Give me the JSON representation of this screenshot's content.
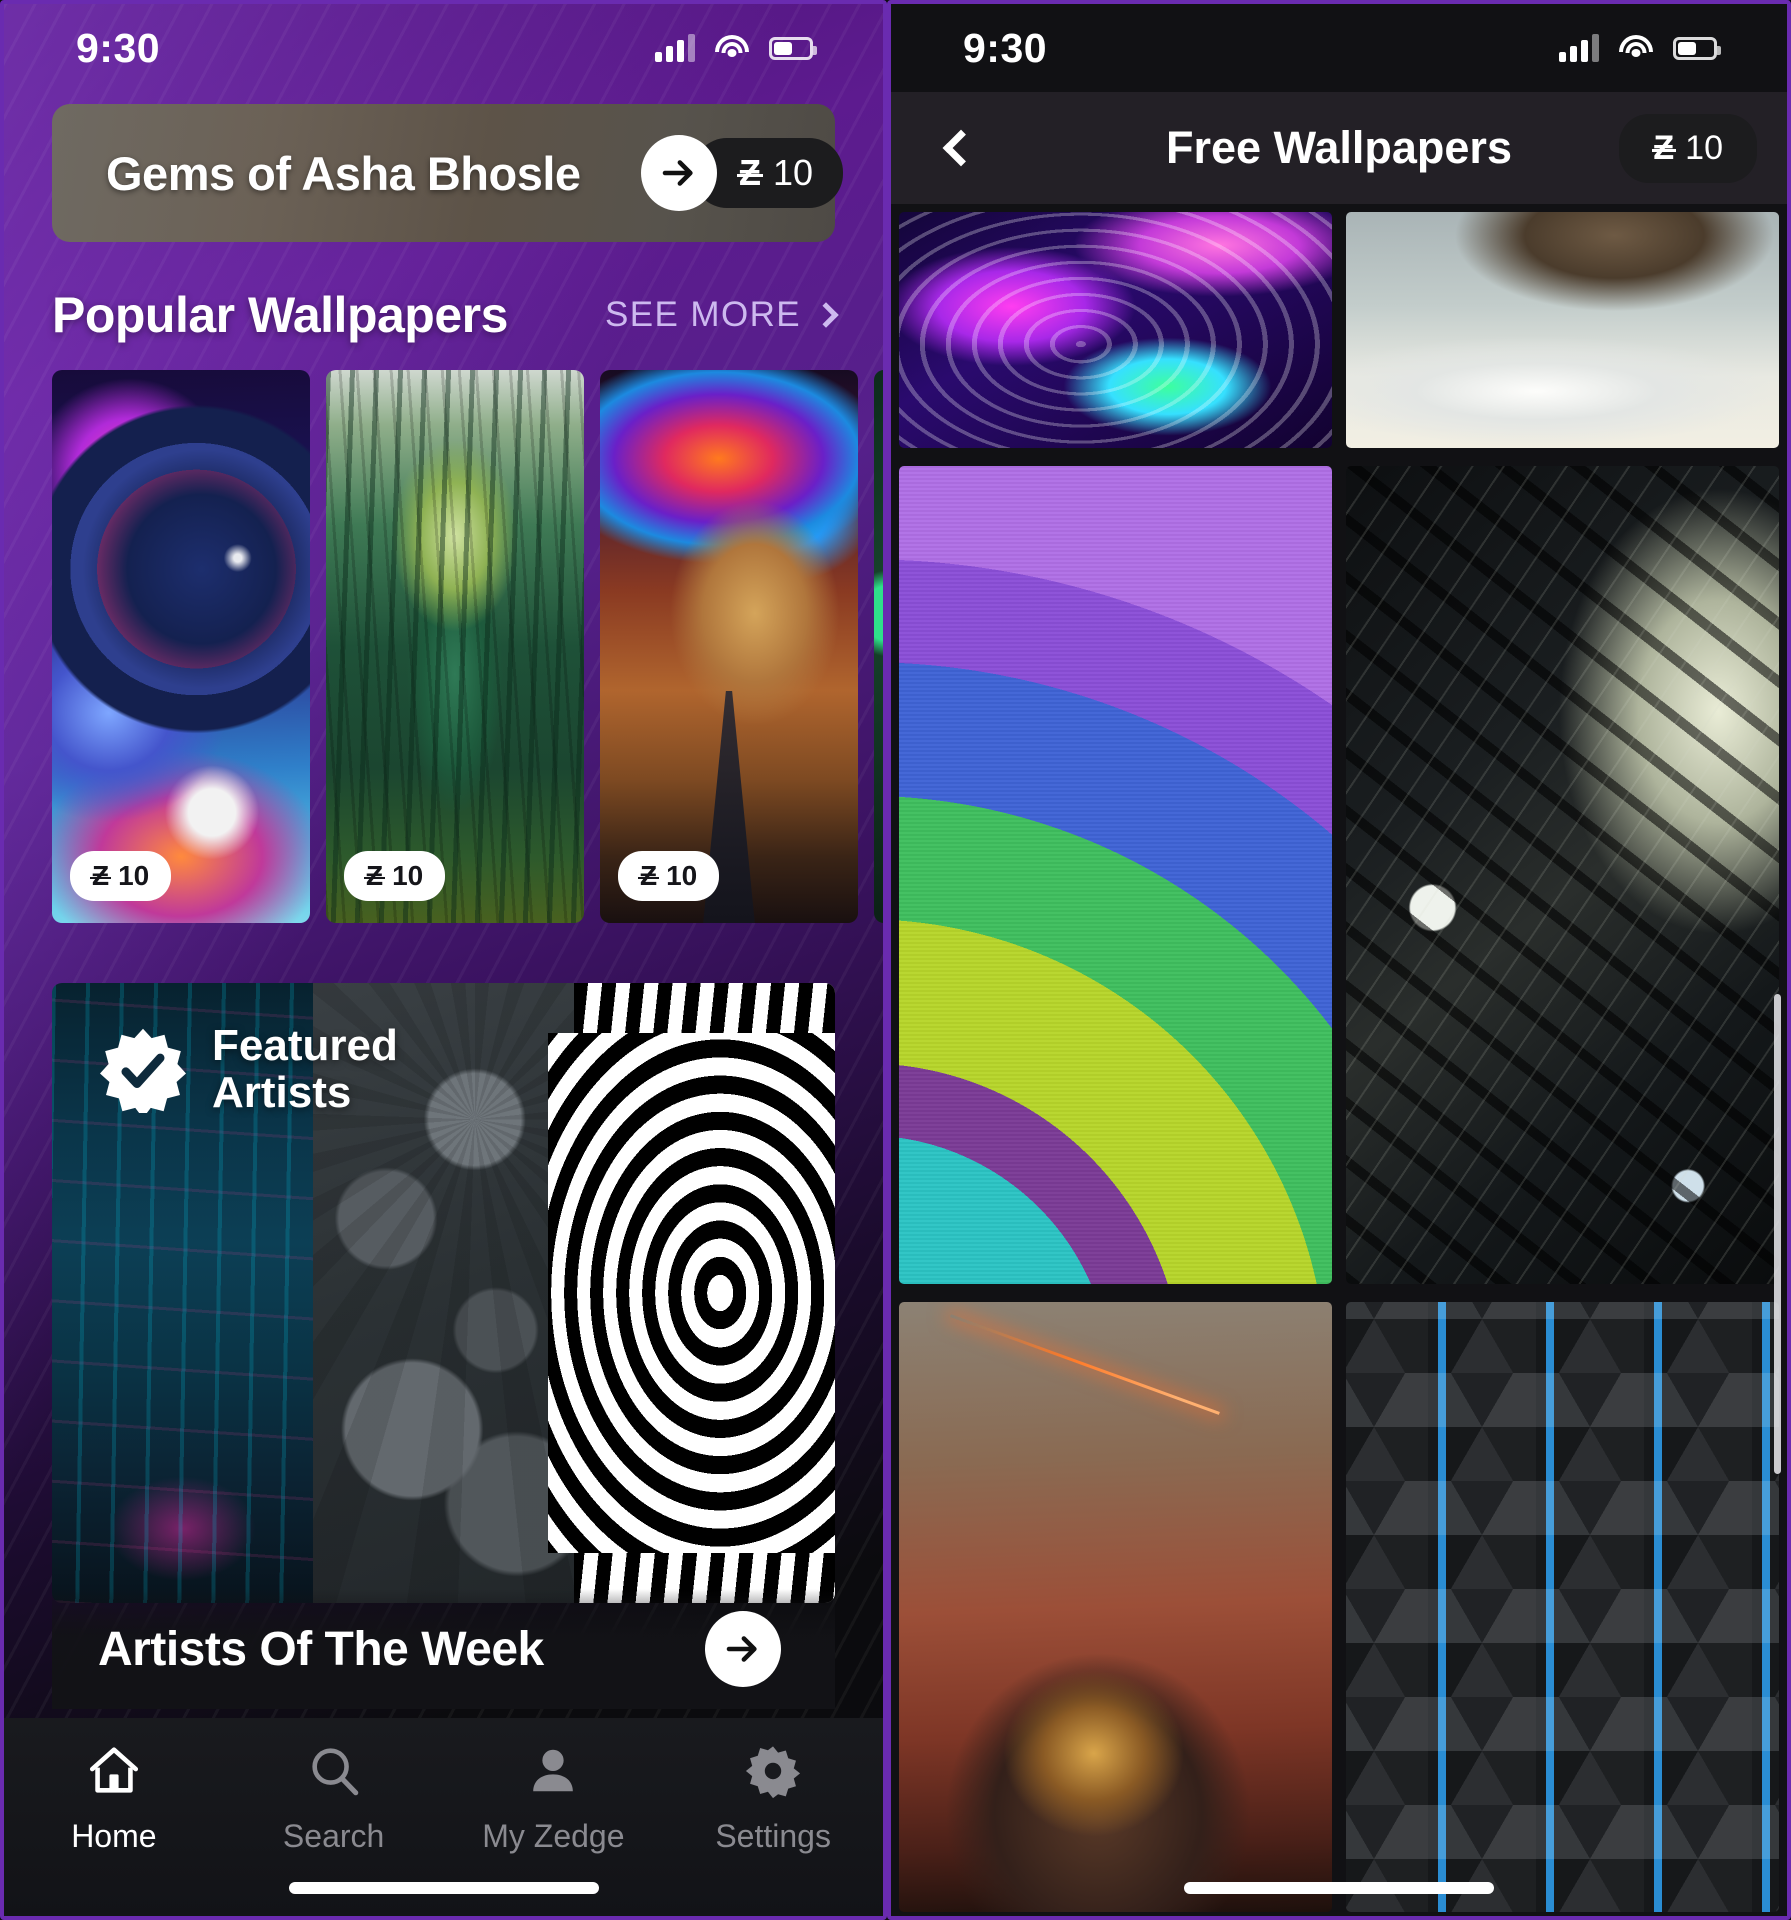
{
  "left": {
    "status": {
      "time": "9:30",
      "signal_icon": "cellular-signal-icon",
      "wifi_icon": "wifi-icon",
      "battery_icon": "battery-icon"
    },
    "hero": {
      "title": "Gems of Asha Bhosle",
      "arrow_icon": "arrow-right-icon",
      "credits_symbol": "Ƶ",
      "credits_value": "10"
    },
    "section": {
      "title": "Popular Wallpapers",
      "see_more": "SEE MORE",
      "chevron_icon": "chevron-right-icon"
    },
    "wallpapers": [
      {
        "name": "cosmic-planets",
        "price_symbol": "Ƶ",
        "price": "10"
      },
      {
        "name": "forest-treehouse",
        "price_symbol": "Ƶ",
        "price": "10"
      },
      {
        "name": "psychedelic-desert-road",
        "price_symbol": "Ƶ",
        "price": "10"
      },
      {
        "name": "green-abstract-partial",
        "price_symbol": "",
        "price": ""
      }
    ],
    "featured": {
      "badge_icon": "verified-starburst-icon",
      "line1": "Featured",
      "line2": "Artists",
      "panes": [
        "neon-city-rain",
        "metal-gears",
        "optical-illusion-stripes"
      ]
    },
    "artists_of_week": {
      "title": "Artists Of The Week",
      "arrow_icon": "arrow-right-icon"
    },
    "tabs": [
      {
        "label": "Home",
        "icon": "home-icon",
        "active": true
      },
      {
        "label": "Search",
        "icon": "search-icon",
        "active": false
      },
      {
        "label": "My Zedge",
        "icon": "person-icon",
        "active": false
      },
      {
        "label": "Settings",
        "icon": "gear-icon",
        "active": false
      }
    ]
  },
  "right": {
    "status": {
      "time": "9:30",
      "signal_icon": "cellular-signal-icon",
      "wifi_icon": "wifi-icon",
      "battery_icon": "battery-icon"
    },
    "header": {
      "back_icon": "chevron-left-icon",
      "title": "Free Wallpapers",
      "credits_symbol": "Ƶ",
      "credits_value": "10"
    },
    "grid": [
      {
        "name": "liquid-neon-abstract"
      },
      {
        "name": "floating-island-clouds"
      },
      {
        "name": "layered-color-arcs"
      },
      {
        "name": "dark-scifi-tech"
      },
      {
        "name": "alien-spider-red-sky"
      },
      {
        "name": "blue-glow-hexagons"
      }
    ]
  }
}
